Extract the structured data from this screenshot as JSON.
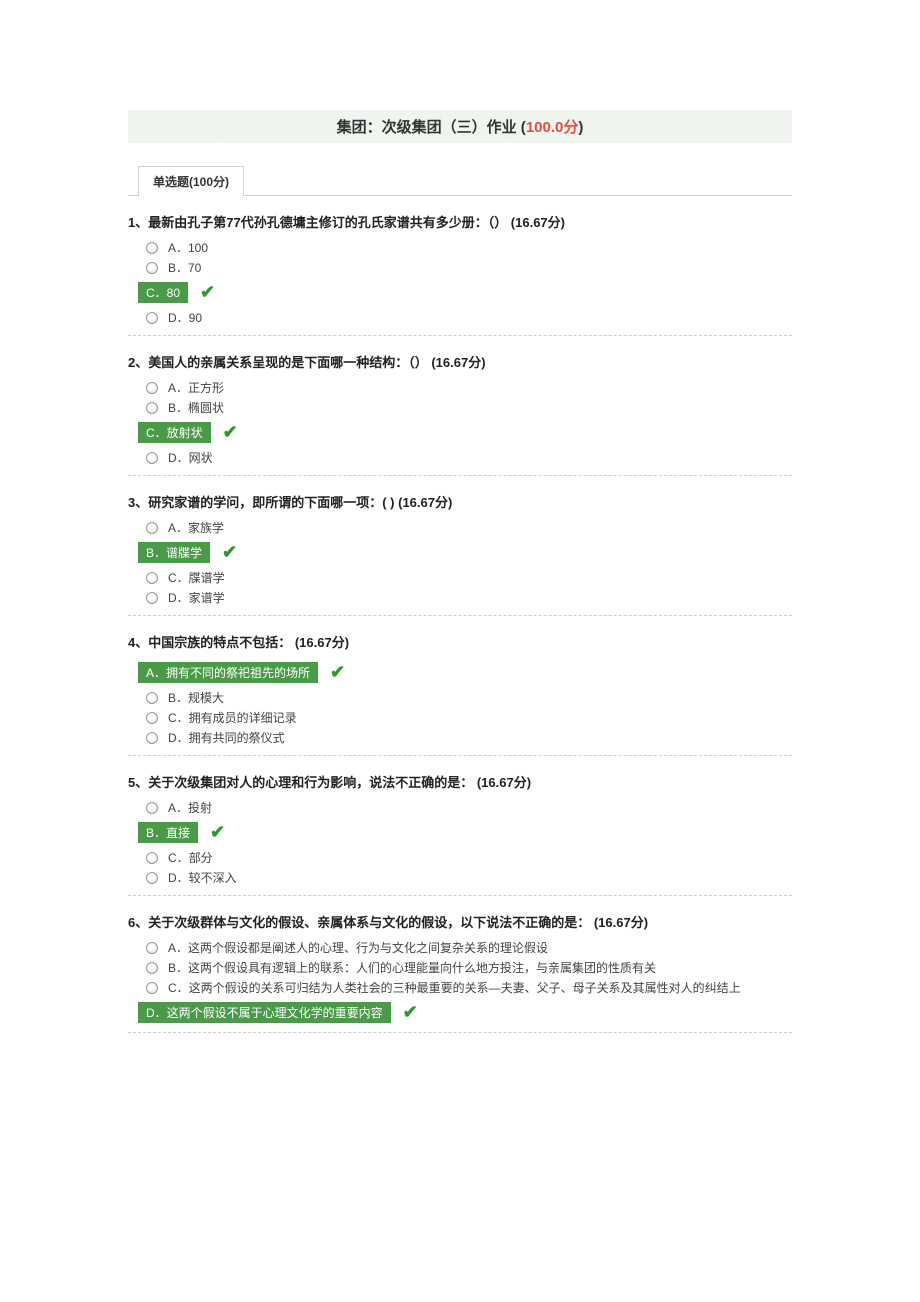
{
  "header": {
    "title_prefix": "集团：次级集团（三）作业 (",
    "score": "100.0分",
    "title_suffix": ")"
  },
  "tab_label": "单选题(100分)",
  "questions": [
    {
      "title": "1、最新由孔子第77代孙孔德墉主修订的孔氏家谱共有多少册：（） (16.67分)",
      "options": [
        {
          "label": "A．100",
          "correct": false
        },
        {
          "label": "B．70",
          "correct": false
        },
        {
          "label": "C．80",
          "correct": true
        },
        {
          "label": "D．90",
          "correct": false
        }
      ]
    },
    {
      "title": "2、美国人的亲属关系呈现的是下面哪一种结构：（） (16.67分)",
      "options": [
        {
          "label": "A．正方形",
          "correct": false
        },
        {
          "label": "B．椭圆状",
          "correct": false
        },
        {
          "label": "C．放射状",
          "correct": true
        },
        {
          "label": "D．网状",
          "correct": false
        }
      ]
    },
    {
      "title": "3、研究家谱的学问，即所谓的下面哪一项：( ) (16.67分)",
      "options": [
        {
          "label": "A．家族学",
          "correct": false
        },
        {
          "label": "B．谱牒学",
          "correct": true
        },
        {
          "label": "C．牒谱学",
          "correct": false
        },
        {
          "label": "D．家谱学",
          "correct": false
        }
      ]
    },
    {
      "title": "4、中国宗族的特点不包括： (16.67分)",
      "options": [
        {
          "label": "A．拥有不同的祭祀祖先的场所",
          "correct": true
        },
        {
          "label": "B．规模大",
          "correct": false
        },
        {
          "label": "C．拥有成员的详细记录",
          "correct": false
        },
        {
          "label": "D．拥有共同的祭仪式",
          "correct": false
        }
      ]
    },
    {
      "title": "5、关于次级集团对人的心理和行为影响，说法不正确的是： (16.67分)",
      "options": [
        {
          "label": "A．投射",
          "correct": false
        },
        {
          "label": "B．直接",
          "correct": true
        },
        {
          "label": "C．部分",
          "correct": false
        },
        {
          "label": "D．较不深入",
          "correct": false
        }
      ]
    },
    {
      "title": "6、关于次级群体与文化的假设、亲属体系与文化的假设，以下说法不正确的是： (16.67分)",
      "options": [
        {
          "label": "A．这两个假设都是阐述人的心理、行为与文化之间复杂关系的理论假设",
          "correct": false
        },
        {
          "label": "B．这两个假设具有逻辑上的联系：人们的心理能量向什么地方投注，与亲属集团的性质有关",
          "correct": false
        },
        {
          "label": "C．这两个假设的关系可归结为人类社会的三种最重要的关系—夫妻、父子、母子关系及其属性对人的纠结上",
          "correct": false
        },
        {
          "label": "D．这两个假设不属于心理文化学的重要内容",
          "correct": true
        }
      ]
    }
  ]
}
